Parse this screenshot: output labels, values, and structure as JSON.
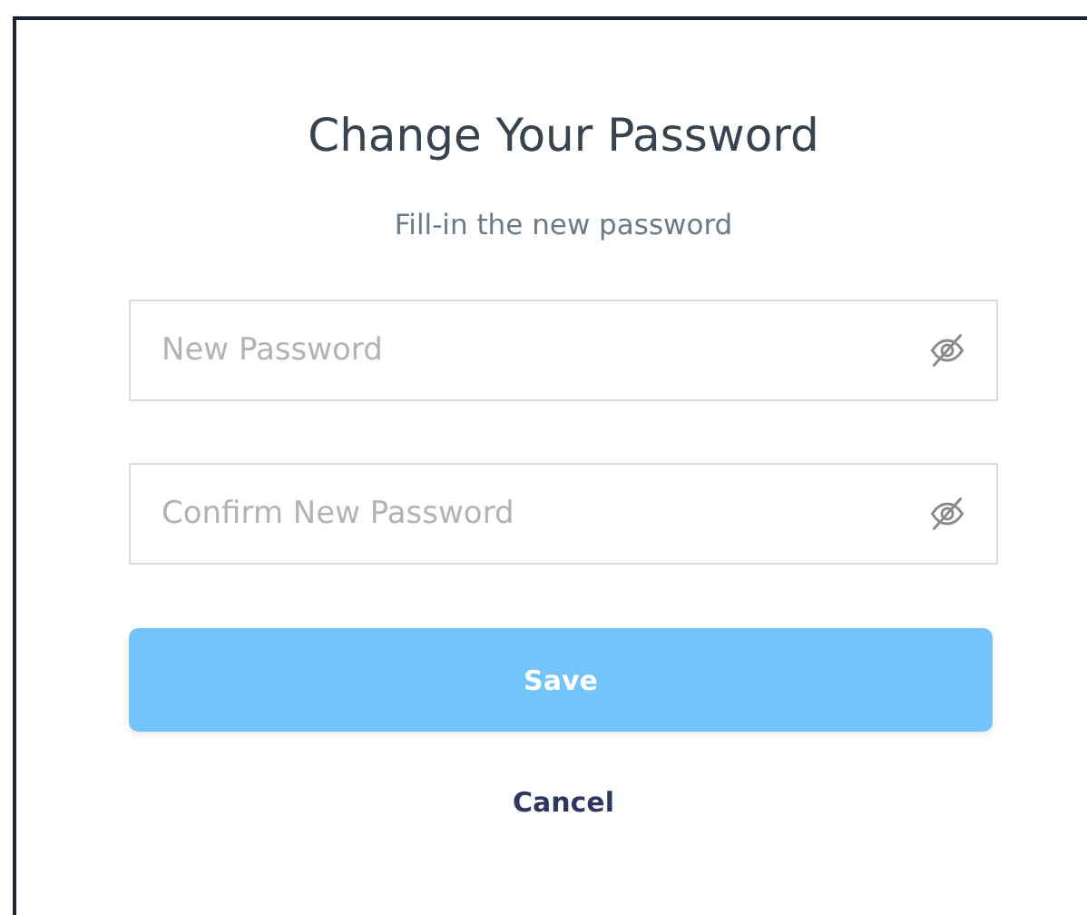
{
  "dialog": {
    "title": "Change Your Password",
    "subtitle": "Fill-in the new password",
    "fields": [
      {
        "placeholder": "New Password"
      },
      {
        "placeholder": "Confirm New Password"
      }
    ],
    "buttons": [
      {
        "kind": "primary",
        "label": "Save"
      },
      {
        "kind": "link",
        "label": "Cancel"
      }
    ]
  }
}
